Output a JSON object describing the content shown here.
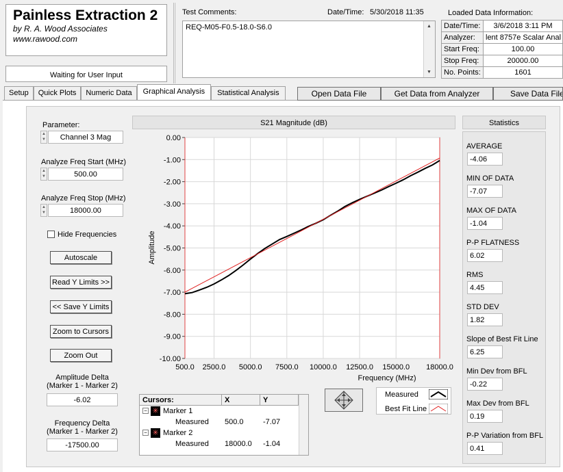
{
  "app": {
    "title": "Painless Extraction 2",
    "company": "by R. A. Wood Associates",
    "website": "www.rawood.com",
    "status": "Waiting for User Input"
  },
  "comments": {
    "label": "Test Comments:",
    "text": "REQ-M05-F0.5-18.0-S6.0"
  },
  "datetime": {
    "label": "Date/Time:",
    "value": "5/30/2018  11:35"
  },
  "loaded": {
    "title": "Loaded Data Information:",
    "rows": [
      {
        "k": "Date/Time:",
        "v": "3/6/2018 3:11 PM"
      },
      {
        "k": "Analyzer:",
        "v": "lent 8757e Scalar Anal"
      },
      {
        "k": "Start Freq:",
        "v": "100.00"
      },
      {
        "k": "Stop Freq:",
        "v": "20000.00"
      },
      {
        "k": "No. Points:",
        "v": "1601"
      }
    ]
  },
  "tabs": [
    "Setup",
    "Quick Plots",
    "Numeric Data",
    "Graphical Analysis",
    "Statistical Analysis"
  ],
  "toolbar": {
    "open": "Open Data File",
    "get": "Get Data from Analyzer",
    "save": "Save Data File"
  },
  "controls": {
    "parameter_label": "Parameter:",
    "parameter_value": "Channel 3 Mag",
    "start_label": "Analyze Freq Start (MHz)",
    "start_value": "500.00",
    "stop_label": "Analyze Freq Stop (MHz)",
    "stop_value": "18000.00",
    "hide_freq": "Hide Frequencies",
    "autoscale": "Autoscale",
    "read_y": "Read Y Limits >>",
    "save_y": "<< Save Y Limits",
    "zoom_cursors": "Zoom to Cursors",
    "zoom_out": "Zoom Out",
    "amp_delta_label1": "Amplitude Delta",
    "amp_delta_label2": "(Marker 1 - Marker 2)",
    "amp_delta_value": "-6.02",
    "freq_delta_label1": "Frequency Delta",
    "freq_delta_label2": "(Marker 1 - Marker 2)",
    "freq_delta_value": "-17500.00"
  },
  "chart_data": {
    "type": "line",
    "title": "S21 Magnitude (dB)",
    "xlabel": "Frequency (MHz)",
    "ylabel": "Amplitude",
    "xlim": [
      500,
      18000
    ],
    "ylim": [
      -10,
      0
    ],
    "xticks": [
      "500.0",
      "2500.0",
      "5000.0",
      "7500.0",
      "10000.0",
      "12500.0",
      "15000.0",
      "18000.0"
    ],
    "xtick_values": [
      500,
      2500,
      5000,
      7500,
      10000,
      12500,
      15000,
      18000
    ],
    "yticks": [
      "0.00",
      "-1.00",
      "-2.00",
      "-3.00",
      "-4.00",
      "-5.00",
      "-6.00",
      "-7.00",
      "-8.00",
      "-9.00",
      "-10.00"
    ],
    "ytick_values": [
      0,
      -1,
      -2,
      -3,
      -4,
      -5,
      -6,
      -7,
      -8,
      -9,
      -10
    ],
    "grid": true,
    "series": [
      {
        "name": "Measured",
        "color": "#000000",
        "x": [
          500,
          1000,
          1500,
          2000,
          2500,
          3000,
          3500,
          4000,
          4500,
          5000,
          5500,
          6000,
          6500,
          7000,
          7500,
          8000,
          8500,
          9000,
          9500,
          10000,
          10500,
          11000,
          11500,
          12000,
          12500,
          13000,
          13500,
          14000,
          14500,
          15000,
          15500,
          16000,
          16500,
          17000,
          17500,
          18000
        ],
        "y": [
          -7.07,
          -7.02,
          -6.9,
          -6.78,
          -6.63,
          -6.45,
          -6.25,
          -6.02,
          -5.77,
          -5.5,
          -5.25,
          -5.02,
          -4.82,
          -4.62,
          -4.48,
          -4.33,
          -4.18,
          -4.02,
          -3.88,
          -3.72,
          -3.52,
          -3.33,
          -3.12,
          -2.95,
          -2.8,
          -2.66,
          -2.52,
          -2.38,
          -2.22,
          -2.07,
          -1.91,
          -1.73,
          -1.57,
          -1.4,
          -1.24,
          -1.04
        ]
      },
      {
        "name": "Best Fit Line",
        "color": "#e02020",
        "x": [
          500,
          18000
        ],
        "y": [
          -7.0,
          -0.93
        ]
      }
    ]
  },
  "legend": {
    "measured": "Measured",
    "bestfit": "Best Fit Line"
  },
  "cursors": {
    "header": "Cursors:",
    "col_x": "X",
    "col_y": "Y",
    "rows": [
      {
        "marker": "Marker 1",
        "sub": "Measured",
        "x": "500.0",
        "y": "-7.07"
      },
      {
        "marker": "Marker 2",
        "sub": "Measured",
        "x": "18000.0",
        "y": "-1.04"
      }
    ]
  },
  "statistics": {
    "title": "Statistics",
    "items": [
      {
        "label": "AVERAGE",
        "value": "-4.06"
      },
      {
        "label": "MIN OF DATA",
        "value": "-7.07"
      },
      {
        "label": "MAX OF DATA",
        "value": "-1.04"
      },
      {
        "label": "P-P FLATNESS",
        "value": "6.02"
      },
      {
        "label": "RMS",
        "value": "4.45"
      },
      {
        "label": "STD DEV",
        "value": "1.82"
      },
      {
        "label": "Slope of Best Fit Line",
        "value": "6.25"
      },
      {
        "label": "Min Dev from BFL",
        "value": "-0.22"
      },
      {
        "label": "Max Dev from BFL",
        "value": "0.19"
      },
      {
        "label": "P-P Variation from BFL",
        "value": "0.41"
      }
    ]
  }
}
